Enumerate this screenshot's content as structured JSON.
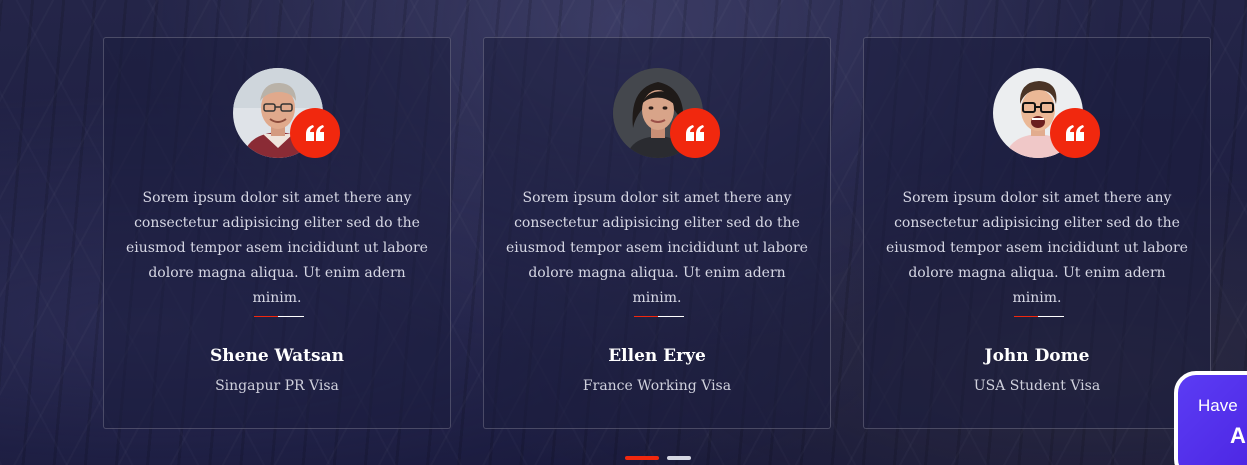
{
  "testimonials": [
    {
      "text": "Sorem ipsum dolor sit amet there any consectetur adipisicing eliter sed do the eiusmod tempor asem incididunt ut labore dolore magna aliqua. Ut enim adern minim.",
      "name": "Shene Watsan",
      "visa": "Singapur PR Visa",
      "avatar_icon": "avatar-older-man-glasses"
    },
    {
      "text": "Sorem ipsum dolor sit amet there any consectetur adipisicing eliter sed do the eiusmod tempor asem incididunt ut labore dolore magna aliqua. Ut enim adern minim.",
      "name": "Ellen Erye",
      "visa": "France Working Visa",
      "avatar_icon": "avatar-woman-dark-hair"
    },
    {
      "text": "Sorem ipsum dolor sit amet there any consectetur adipisicing eliter sed do the eiusmod tempor asem incididunt ut labore dolore magna aliqua. Ut enim adern minim.",
      "name": "John Dome",
      "visa": "USA Student Visa",
      "avatar_icon": "avatar-young-man-glasses"
    }
  ],
  "quote_icon": "quote-icon",
  "pagination": {
    "pages": 2,
    "active": 1
  },
  "help_widget": {
    "line1": "Have",
    "line2": "A"
  },
  "colors": {
    "accent": "#f1280e",
    "background": "#1c1d3e",
    "widget": "#5b3cf4"
  }
}
